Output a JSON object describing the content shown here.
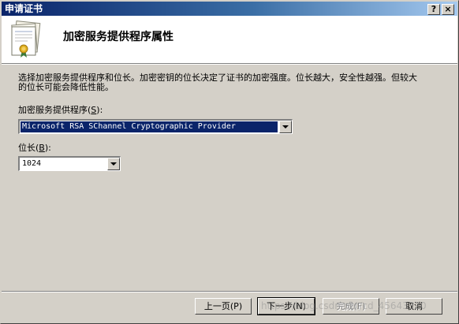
{
  "window": {
    "title": "申请证书",
    "help_button": "?",
    "close_button": "×"
  },
  "header": {
    "title": "加密服务提供程序属性",
    "icon": "certificate-icon"
  },
  "description": "选择加密服务提供程序和位长。加密密钥的位长决定了证书的加密强度。位长越大，安全性越强。但较大的位长可能会降低性能。",
  "csp": {
    "label_text": "加密服务提供程序",
    "label_accel_open": "(",
    "label_accel": "S",
    "label_accel_close": "):",
    "value": "Microsoft RSA SChannel Cryptographic Provider"
  },
  "bitlength": {
    "label_text": "位长",
    "label_accel_open": "(",
    "label_accel": "B",
    "label_accel_close": "):",
    "value": "1024"
  },
  "buttons": {
    "back": "上一页(P)",
    "next": "下一步(N)",
    "finish": "完成(F)",
    "cancel": "取消"
  },
  "watermark": "https://blog.csdn.net/cd_45643320"
}
